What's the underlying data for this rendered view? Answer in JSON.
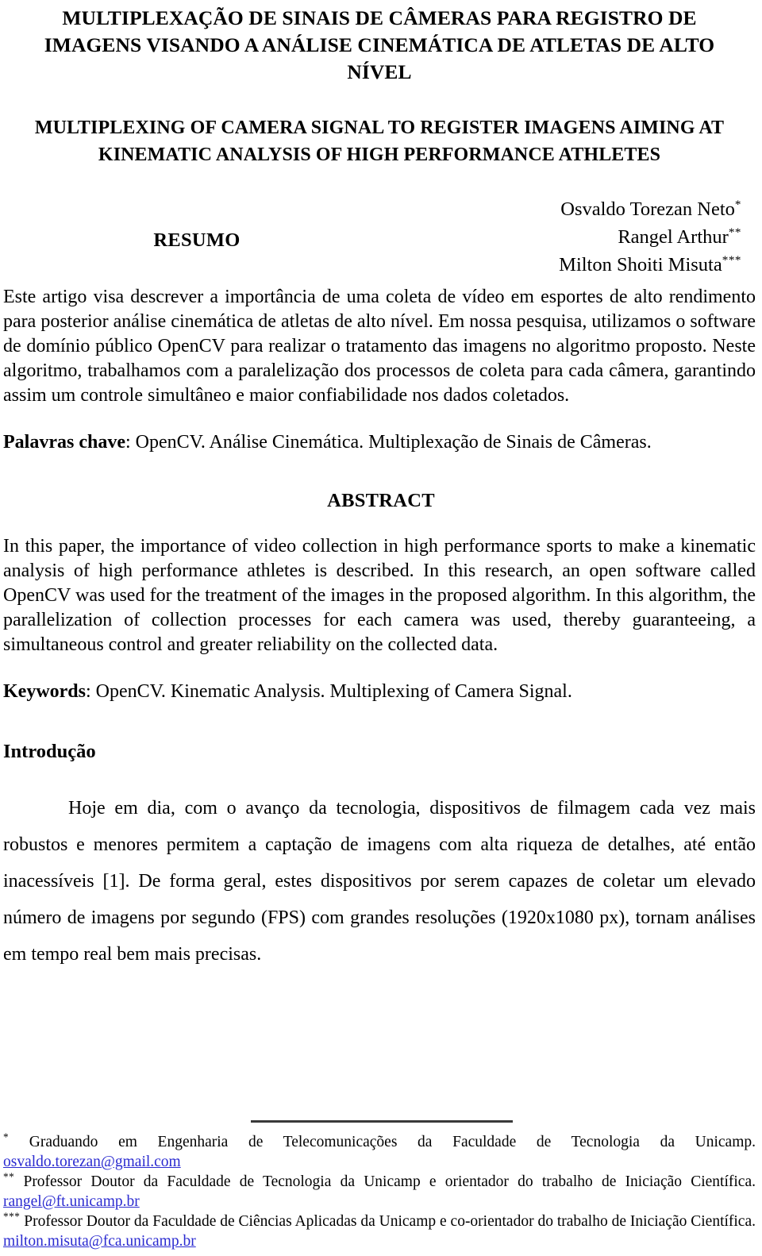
{
  "document": {
    "title_pt": "MULTIPLEXAÇÃO DE SINAIS DE CÂMERAS PARA REGISTRO DE IMAGENS VISANDO A ANÁLISE CINEMÁTICA DE ATLETAS DE ALTO NÍVEL",
    "title_en": "MULTIPLEXING OF CAMERA SIGNAL TO REGISTER IMAGENS AIMING AT KINEMATIC ANALYSIS OF HIGH PERFORMANCE ATHLETES"
  },
  "authors": [
    {
      "name": "Osvaldo Torezan Neto",
      "marker": "*"
    },
    {
      "name": "Rangel Arthur",
      "marker": "**"
    },
    {
      "name": "Milton Shoiti Misuta",
      "marker": "***"
    }
  ],
  "resumo": {
    "heading": "RESUMO",
    "body": "Este artigo visa descrever a importância de uma coleta de vídeo em esportes de alto rendimento para posterior análise cinemática de atletas de alto nível. Em nossa pesquisa, utilizamos o software de domínio público OpenCV para realizar o tratamento das imagens no algoritmo proposto. Neste algoritmo, trabalhamos com a paralelização dos processos de coleta para cada câmera, garantindo assim um controle simultâneo e maior confiabilidade nos dados coletados.",
    "keywords_label": "Palavras chave",
    "keywords_value": ": OpenCV. Análise Cinemática. Multiplexação de Sinais de Câmeras."
  },
  "abstract": {
    "heading": "ABSTRACT",
    "body": "In this paper, the importance of video collection in high performance sports to make a kinematic analysis of high performance athletes is described. In this research, an open software called OpenCV was used for the treatment of the images in the proposed algorithm. In this algorithm, the parallelization of collection processes for each camera was used, thereby guaranteeing, a simultaneous control and greater reliability on the collected data.",
    "keywords_label": "Keywords",
    "keywords_value": ": OpenCV. Kinematic Analysis. Multiplexing of Camera Signal."
  },
  "introduction": {
    "heading": "Introdução",
    "body": "Hoje em dia, com o avanço da tecnologia, dispositivos de filmagem cada vez mais robustos e menores permitem a captação de imagens com alta riqueza de detalhes, até então inacessíveis [1]. De forma geral, estes dispositivos por serem capazes de coletar um elevado número de imagens por segundo (FPS) com grandes resoluções (1920x1080 px), tornam análises em tempo real bem mais precisas."
  },
  "footnotes": [
    {
      "marker": "*",
      "text": "Graduando em Engenharia de Telecomunicações da Faculdade de Tecnologia da Unicamp. ",
      "email": "osvaldo.torezan@gmail.com",
      "tail": ""
    },
    {
      "marker": "**",
      "text": "Professor Doutor da Faculdade de Tecnologia da Unicamp e orientador do trabalho de Iniciação Científica. ",
      "email": "rangel@ft.unicamp.br",
      "tail": ""
    },
    {
      "marker": "***",
      "text": "Professor Doutor da Faculdade de Ciências Aplicadas da Unicamp e co-orientador do trabalho de Iniciação Científica. ",
      "email": "milton.misuta@fca.unicamp.br",
      "tail": ""
    }
  ],
  "colors": {
    "link": "#2a2ad0",
    "rule": "#3a3a3a",
    "text": "#000000"
  }
}
